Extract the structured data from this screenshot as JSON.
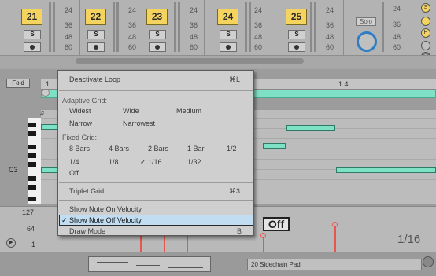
{
  "mixer": {
    "tracks": [
      {
        "number": "21",
        "solo": "S"
      },
      {
        "number": "22",
        "solo": "S"
      },
      {
        "number": "23",
        "solo": "S"
      },
      {
        "number": "24",
        "solo": "S"
      },
      {
        "number": "25",
        "solo": "S"
      }
    ],
    "db_scale": [
      "24",
      "36",
      "48",
      "60"
    ],
    "master_solo": "Solo",
    "right_s": "S",
    "right_h": "H"
  },
  "editor": {
    "fold_label": "Fold",
    "ruler_start": "1",
    "ruler_mark": "1.4",
    "key_label": "C3",
    "velocity_scale": [
      "127",
      "64",
      "1"
    ],
    "off_label": "Off",
    "grid_label": "1/16"
  },
  "context_menu": {
    "deactivate_loop": "Deactivate Loop",
    "deactivate_loop_shortcut": "⌘L",
    "adaptive_grid_header": "Adaptive Grid:",
    "adaptive": {
      "widest": "Widest",
      "wide": "Wide",
      "medium": "Medium",
      "narrow": "Narrow",
      "narrowest": "Narrowest"
    },
    "fixed_grid_header": "Fixed Grid:",
    "fixed": {
      "b8": "8 Bars",
      "b4": "4 Bars",
      "b2": "2 Bars",
      "b1": "1 Bar",
      "half": "1/2",
      "quarter": "1/4",
      "eighth": "1/8",
      "sixteenth": "✓ 1/16",
      "thirtysecond": "1/32",
      "off": "Off"
    },
    "triplet_grid": "Triplet Grid",
    "triplet_shortcut": "⌘3",
    "show_note_on_velocity": "Show Note On Velocity",
    "show_note_off_velocity": "✓ Show Note Off Velocity",
    "draw_mode": "Draw Mode",
    "draw_mode_shortcut": "B"
  },
  "bottom": {
    "device_name": "20 Sidechain Pad"
  },
  "colors": {
    "track_number": "#f4d35e",
    "note": "#7ee0c5",
    "velocity": "#e8574d",
    "menu_highlight": "#c0ddf2"
  }
}
